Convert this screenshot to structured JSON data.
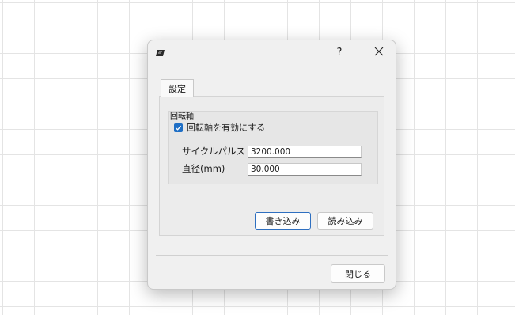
{
  "titlebar": {
    "help_label": "?",
    "icons": {
      "app": "app-icon",
      "close": "close-icon"
    }
  },
  "tabs": [
    {
      "label": "設定",
      "selected": true
    }
  ],
  "group": {
    "title": "回転軸",
    "checkbox": {
      "label": "回転軸を有効にする",
      "checked": true
    },
    "fields": [
      {
        "label": "サイクルパルス",
        "value": "3200.000"
      },
      {
        "label": "直径(mm)",
        "value": "30.000"
      }
    ]
  },
  "buttons": {
    "write": "書き込み",
    "read": "読み込み",
    "close": "閉じる"
  },
  "colors": {
    "accent": "#1f6fc5",
    "dialog_bg": "#f0f0f0"
  }
}
